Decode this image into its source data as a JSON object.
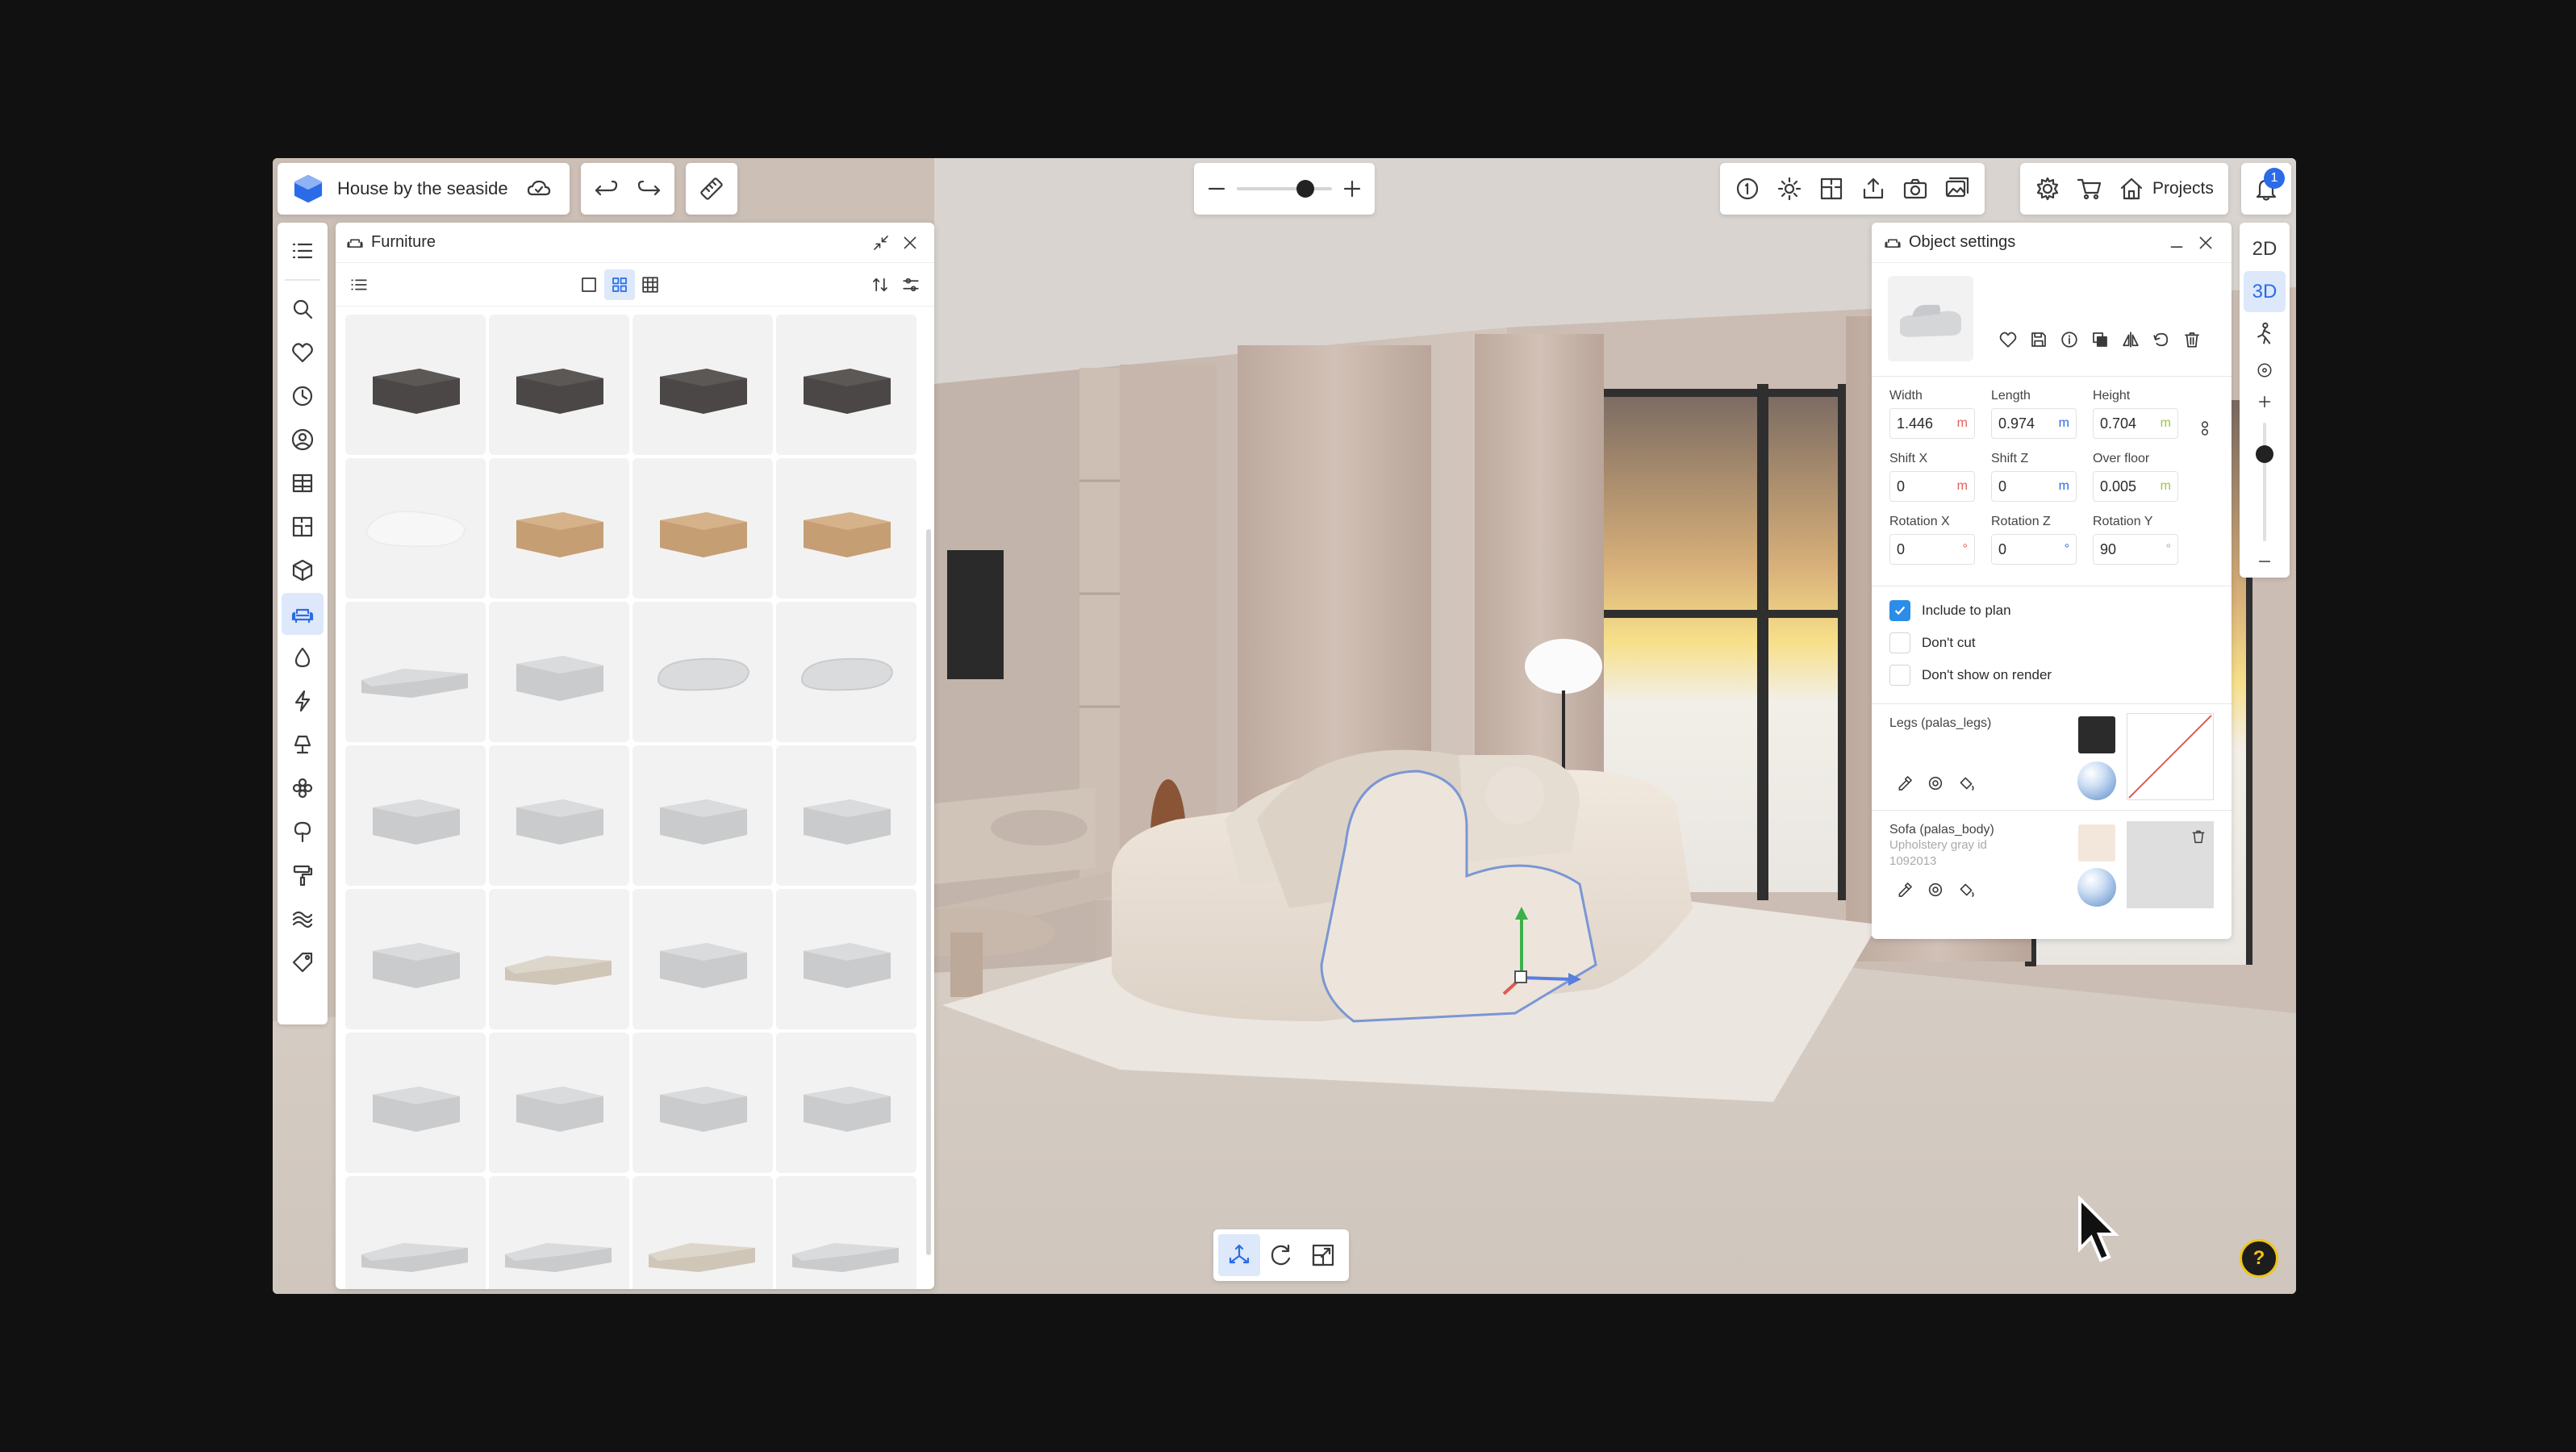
{
  "project": {
    "title": "House by the seaside"
  },
  "toolbar": {
    "projects_label": "Projects",
    "notifications_count": "1",
    "zoom_level": 0.72
  },
  "furniture_panel": {
    "title": "Furniture",
    "items": [
      "dark-block-sofa",
      "dark-tufted-sofa",
      "dark-tufted-sofa-2",
      "dark-block-module",
      "white-curved-sofa",
      "tan-modular-sofa",
      "tan-chaise",
      "tan-tufted-sofa",
      "gray-sectional-set",
      "gray-ottoman",
      "gray-cushion",
      "gray-cushion-angled",
      "gray-chaise",
      "gray-pouf",
      "gray-armless-chair",
      "gray-corner-module",
      "gray-lounge-module",
      "beige-sectional",
      "gray-chaise-module",
      "gray-chaise-low",
      "gray-block-side",
      "gray-double-module",
      "gray-corner-block",
      "gray-flat-module",
      "gray-large-sectional",
      "gray-u-sectional",
      "beige-l-sectional",
      "gray-long-sectional"
    ]
  },
  "object_settings": {
    "title": "Object settings",
    "fields": {
      "width": {
        "label": "Width",
        "value": "1.446",
        "unit": "m"
      },
      "length": {
        "label": "Length",
        "value": "0.974",
        "unit": "m"
      },
      "height": {
        "label": "Height",
        "value": "0.704",
        "unit": "m"
      },
      "shift_x": {
        "label": "Shift X",
        "value": "0",
        "unit": "m"
      },
      "shift_z": {
        "label": "Shift Z",
        "value": "0",
        "unit": "m"
      },
      "over_floor": {
        "label": "Over floor",
        "value": "0.005",
        "unit": "m"
      },
      "rotation_x": {
        "label": "Rotation X",
        "value": "0",
        "unit": "°"
      },
      "rotation_z": {
        "label": "Rotation Z",
        "value": "0",
        "unit": "°"
      },
      "rotation_y": {
        "label": "Rotation Y",
        "value": "90",
        "unit": "°"
      }
    },
    "checkboxes": {
      "include_to_plan": {
        "label": "Include to plan",
        "checked": true
      },
      "dont_cut": {
        "label": "Don't cut",
        "checked": false
      },
      "dont_show_on_render": {
        "label": "Don't show on render",
        "checked": false
      }
    },
    "materials": {
      "legs": {
        "name": "Legs (palas_legs)",
        "color": "#2b2b2b"
      },
      "body": {
        "name": "Sofa (palas_body)",
        "description": "Upholstery gray id",
        "id": "1092013",
        "color": "#f3e6da"
      }
    }
  },
  "view_modes": {
    "mode_2d": "2D",
    "mode_3d": "3D"
  },
  "help_label": "?",
  "colors": {
    "accent": "#2b6be8",
    "active_bg": "#dde8fb",
    "help_ring": "#f0c419"
  }
}
